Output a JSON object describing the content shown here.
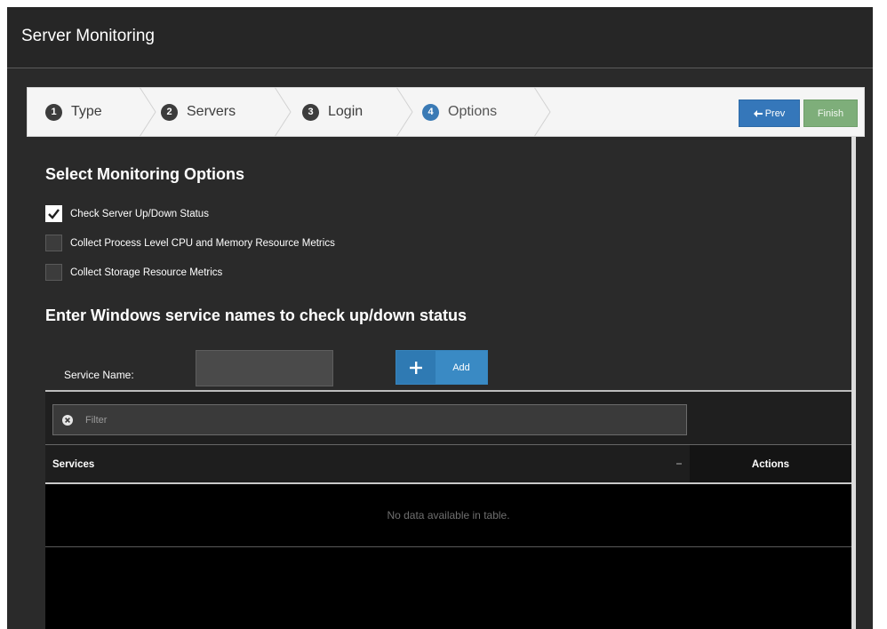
{
  "modal": {
    "title": "Server Monitoring",
    "close_symbol": "×"
  },
  "wizard": {
    "steps": [
      {
        "number": "1",
        "label": "Type"
      },
      {
        "number": "2",
        "label": "Servers"
      },
      {
        "number": "3",
        "label": "Login"
      },
      {
        "number": "4",
        "label": "Options"
      }
    ],
    "active_step": 4,
    "prev_label": "Prev",
    "finish_label": "Finish"
  },
  "options": {
    "heading": "Select Monitoring Options",
    "checkboxes": [
      {
        "label": "Check Server Up/Down Status",
        "checked": true
      },
      {
        "label": "Collect Process Level CPU and Memory Resource Metrics",
        "checked": false
      },
      {
        "label": "Collect Storage Resource Metrics",
        "checked": false
      }
    ]
  },
  "services": {
    "heading": "Enter Windows service names to check up/down status",
    "name_label": "Service Name:",
    "name_value": "",
    "add_label": "Add",
    "filter_placeholder": "Filter",
    "columns": [
      "Services",
      "Actions"
    ],
    "empty_message": "No data available in table."
  },
  "colors": {
    "modal_bg": "#2a2a2a",
    "accent_blue": "#3577ba",
    "finish_green": "#7eae7a"
  }
}
